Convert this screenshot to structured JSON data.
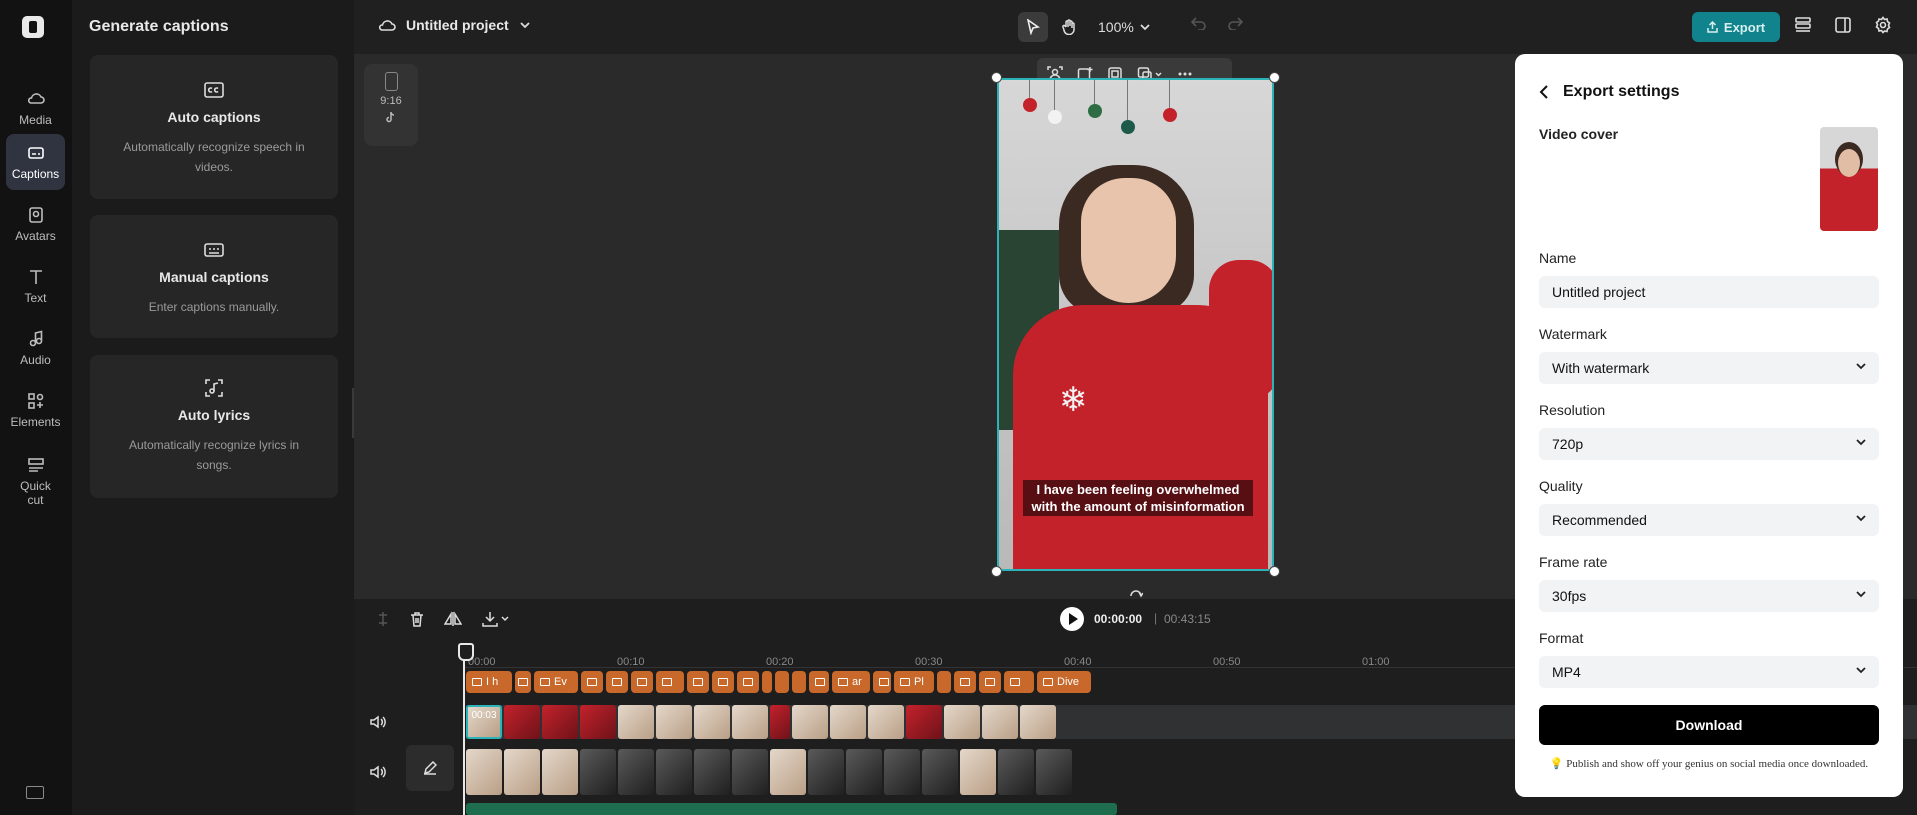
{
  "rail": {
    "items": [
      {
        "label": "Media",
        "icon": "media-icon"
      },
      {
        "label": "Captions",
        "icon": "captions-icon"
      },
      {
        "label": "Avatars",
        "icon": "avatars-icon"
      },
      {
        "label": "Text",
        "icon": "text-icon"
      },
      {
        "label": "Audio",
        "icon": "audio-icon"
      },
      {
        "label": "Elements",
        "icon": "elements-icon"
      },
      {
        "label": "Quick cut",
        "icon": "quick-cut-icon"
      }
    ]
  },
  "captions_panel": {
    "title": "Generate captions",
    "cards": [
      {
        "title": "Auto captions",
        "desc": "Automatically recognize speech in videos."
      },
      {
        "title": "Manual captions",
        "desc": "Enter captions manually."
      },
      {
        "title": "Auto lyrics",
        "desc": "Automatically recognize lyrics in songs."
      }
    ]
  },
  "topbar": {
    "project_name": "Untitled project",
    "zoom": "100%",
    "export_label": "Export"
  },
  "canvas": {
    "ratio": "9:16",
    "subtitle_line1": "I have been feeling overwhelmed",
    "subtitle_line2": "with the amount of misinformation"
  },
  "timeline": {
    "current_time": "00:00:00",
    "separator": "|",
    "total_time": "00:43:15",
    "ticks": [
      "00:00",
      "00:10",
      "00:20",
      "00:30",
      "00:40",
      "00:50",
      "01:00"
    ],
    "caption_segments": [
      "I h",
      "",
      "Ev",
      "",
      "",
      "",
      "",
      "",
      "",
      "",
      "",
      "",
      "",
      "",
      "ar",
      "",
      "Pl",
      "",
      "",
      "",
      "",
      "Dive"
    ],
    "clip_label": "00:03"
  },
  "export_panel": {
    "title": "Export settings",
    "video_cover_label": "Video cover",
    "name_label": "Name",
    "name_value": "Untitled project",
    "watermark_label": "Watermark",
    "watermark_value": "With watermark",
    "resolution_label": "Resolution",
    "resolution_value": "720p",
    "quality_label": "Quality",
    "quality_value": "Recommended",
    "framerate_label": "Frame rate",
    "framerate_value": "30fps",
    "format_label": "Format",
    "format_value": "MP4",
    "download_label": "Download",
    "tip": "💡 Publish and show off your genius on social media once downloaded."
  },
  "colors": {
    "accent": "#11838d",
    "caption_track": "#c8682a",
    "selection": "#2bb3b8"
  }
}
